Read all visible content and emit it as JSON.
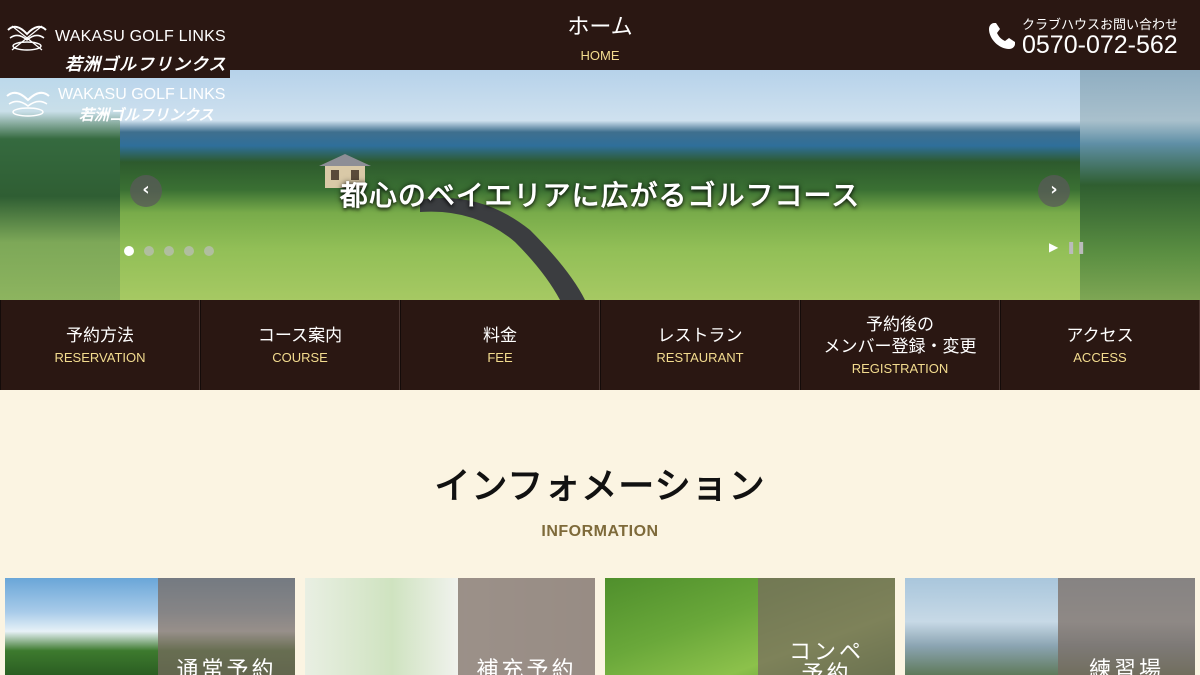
{
  "header": {
    "logo_en": "WAKASU GOLF LINKS",
    "logo_jp": "若洲ゴルフリンクス",
    "page_title": "ホーム",
    "page_subtitle": "HOME",
    "contact_label": "クラブハウスお問い合わせ",
    "contact_number": "0570-072-562"
  },
  "slider": {
    "logo_en": "WAKASU GOLF LINKS",
    "logo_jp": "若洲ゴルフリンクス",
    "caption": "都心のベイエリアに広がるゴルフコース",
    "prev_icon": "‹",
    "next_icon": "›",
    "slide_count": 5,
    "active_slide": 1,
    "play_icon": "▶",
    "pause_icon": "❚❚"
  },
  "nav": {
    "items": [
      {
        "ja": "予約方法",
        "en": "RESERVATION"
      },
      {
        "ja": "コース案内",
        "en": "COURSE"
      },
      {
        "ja": "料金",
        "en": "FEE"
      },
      {
        "ja": "レストラン",
        "en": "RESTAURANT"
      },
      {
        "ja": "予約後の\nメンバー登録・変更",
        "en": "REGISTRATION"
      },
      {
        "ja": "アクセス",
        "en": "ACCESS"
      }
    ]
  },
  "information": {
    "title": "インフォメーション",
    "subtitle": "INFORMATION",
    "cards": [
      {
        "label": "通常予約"
      },
      {
        "label": "補充予約"
      },
      {
        "label": "コンペ\n予約"
      },
      {
        "label": "練習場"
      }
    ]
  },
  "colors": {
    "header_bg": "#2a1712",
    "accent_gold": "#f3dc8f",
    "page_bg": "#fbf4e2",
    "info_subtitle": "#7e6a3a"
  }
}
